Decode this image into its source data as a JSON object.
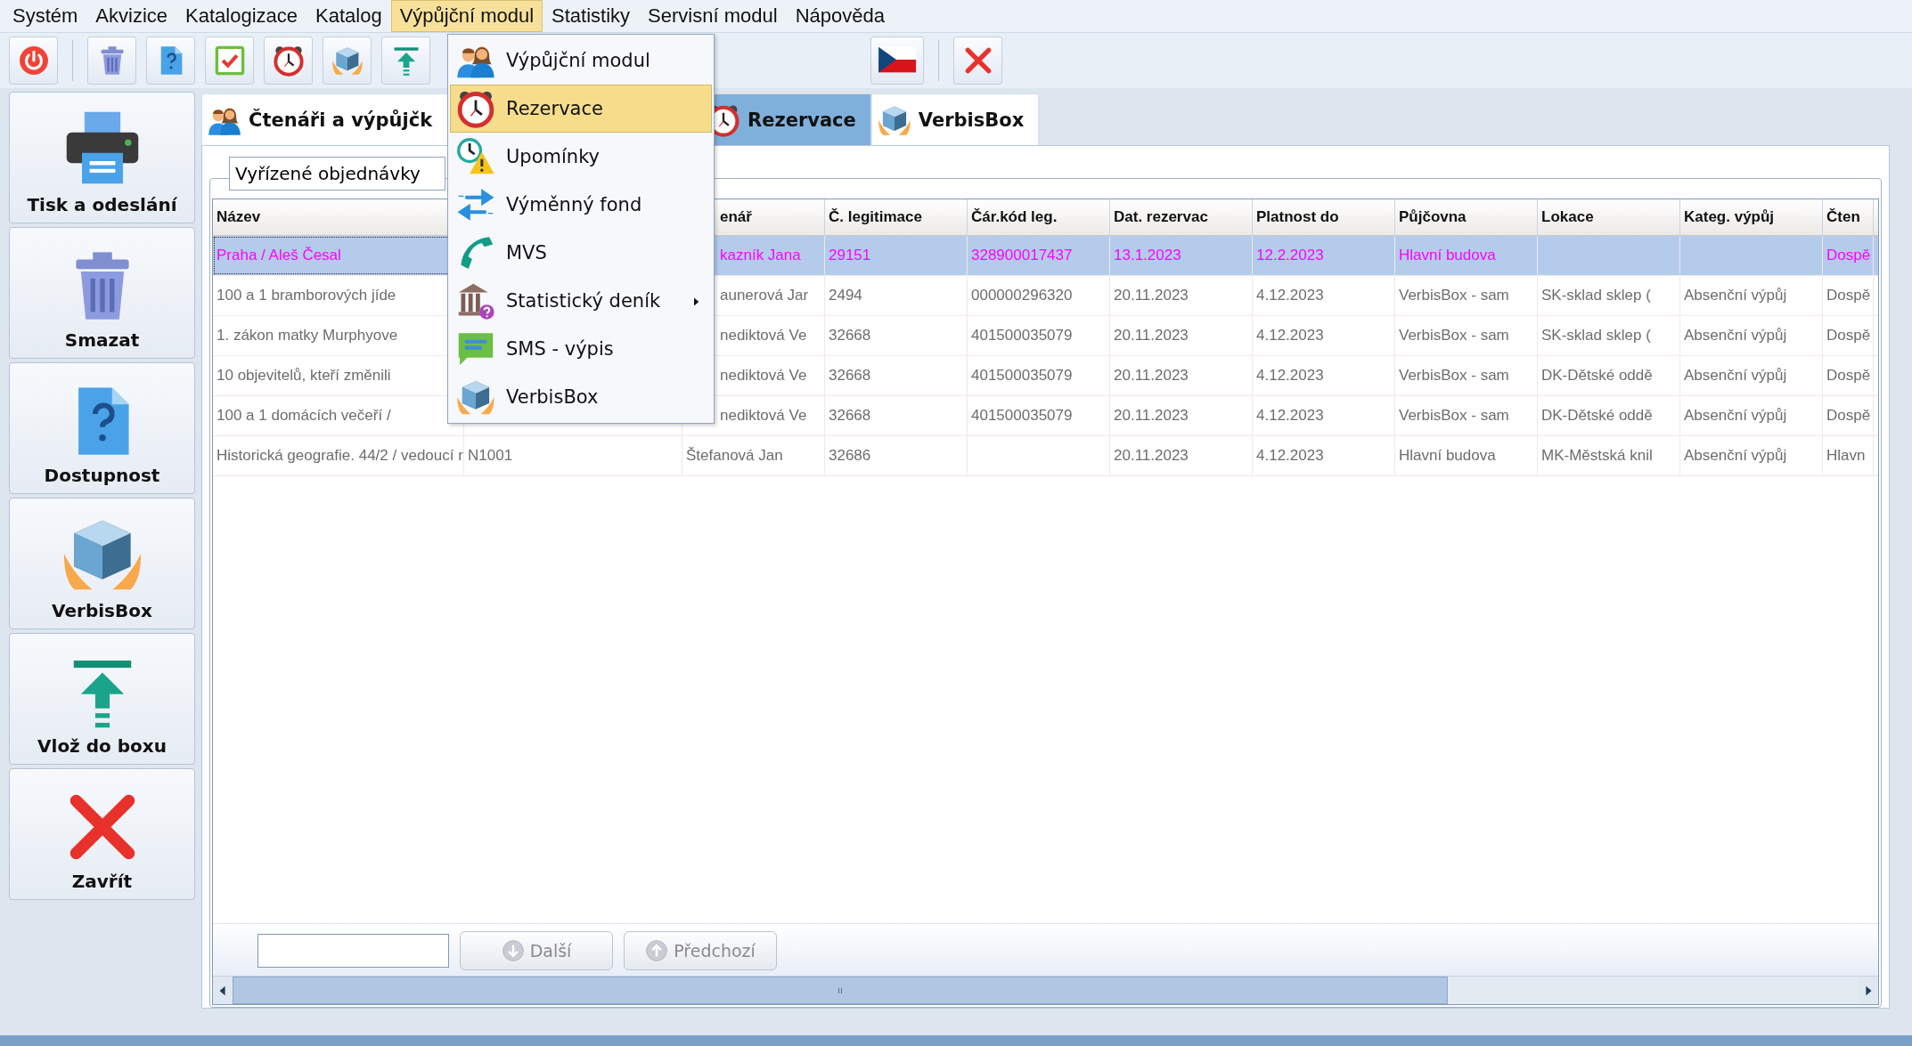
{
  "menu_bar": [
    {
      "label": "Systém",
      "selected": false
    },
    {
      "label": "Akvizice",
      "selected": false
    },
    {
      "label": "Katalogizace",
      "selected": false
    },
    {
      "label": "Katalog",
      "selected": false
    },
    {
      "label": "Výpůjční modul",
      "selected": true
    },
    {
      "label": "Statistiky",
      "selected": false
    },
    {
      "label": "Servisní modul",
      "selected": false
    },
    {
      "label": "Nápověda",
      "selected": false
    }
  ],
  "dropdown_menu": [
    {
      "label": "Výpůjční modul",
      "selected": false,
      "submenu": false
    },
    {
      "label": "Rezervace",
      "selected": true,
      "submenu": false
    },
    {
      "label": "Upomínky",
      "selected": false,
      "submenu": false
    },
    {
      "label": "Výměnný fond",
      "selected": false,
      "submenu": false
    },
    {
      "label": "MVS",
      "selected": false,
      "submenu": false
    },
    {
      "label": "Statistický deník",
      "selected": false,
      "submenu": true
    },
    {
      "label": "SMS - výpis",
      "selected": false,
      "submenu": false
    },
    {
      "label": "VerbisBox",
      "selected": false,
      "submenu": false
    }
  ],
  "sidebar": [
    {
      "label": "Tisk a odeslání"
    },
    {
      "label": "Smazat"
    },
    {
      "label": "Dostupnost"
    },
    {
      "label": "VerbisBox"
    },
    {
      "label": "Vlož do boxu"
    },
    {
      "label": "Zavřít"
    }
  ],
  "tabs": [
    {
      "label": "Čtenáři a výpůjčk",
      "selected": false
    },
    {
      "label": "Rezervace",
      "selected": true
    },
    {
      "label": "VerbisBox",
      "selected": false
    }
  ],
  "filter": {
    "value": "Vyřízené objednávky"
  },
  "table": {
    "columns": [
      "Název",
      null,
      "enář",
      "Č. legitimace",
      "Čár.kód leg.",
      "Dat. rezervac",
      "Platnost do",
      "Půjčovna",
      "Lokace",
      "Kateg. výpůj",
      "Čten"
    ],
    "rows": [
      {
        "selected": true,
        "cells": [
          "Praha / Aleš Česal",
          null,
          "kazník Jana",
          "29151",
          "328900017437",
          "13.1.2023",
          "12.2.2023",
          "Hlavní budova",
          null,
          null,
          "Dospě"
        ]
      },
      {
        "selected": false,
        "cells": [
          "100 a 1 bramborových jíde",
          null,
          "aunerová Jar",
          "2494",
          "000000296320",
          "20.11.2023",
          "4.12.2023",
          "VerbisBox - sam",
          "SK-sklad sklep (",
          "Absenční výpůj",
          "Dospě"
        ]
      },
      {
        "selected": false,
        "cells": [
          "1. zákon matky Murphyove",
          null,
          "nediktová Ve",
          "32668",
          "401500035079",
          "20.11.2023",
          "4.12.2023",
          "VerbisBox - sam",
          "SK-sklad sklep (",
          "Absenční výpůj",
          "Dospě"
        ]
      },
      {
        "selected": false,
        "cells": [
          "10 objevitelů, kteří změnili",
          null,
          "nediktová Ve",
          "32668",
          "401500035079",
          "20.11.2023",
          "4.12.2023",
          "VerbisBox - sam",
          "DK-Dětské oddě",
          "Absenční výpůj",
          "Dospě"
        ]
      },
      {
        "selected": false,
        "cells": [
          "100 a 1 domácích večeří /",
          null,
          "nediktová Ve",
          "32668",
          "401500035079",
          "20.11.2023",
          "4.12.2023",
          "VerbisBox - sam",
          "DK-Dětské oddě",
          "Absenční výpůj",
          "Dospě"
        ]
      },
      {
        "selected": false,
        "cells": [
          "Historická geografie. 44/2 / vedoucí r",
          "N1001",
          "Štefanová  Jan",
          "32686",
          null,
          "20.11.2023",
          "4.12.2023",
          "Hlavní budova",
          "MK-Městská knil",
          "Absenční výpůj",
          "Hlavn"
        ]
      }
    ]
  },
  "nav_buttons": [
    {
      "label": "Další",
      "disabled": true
    },
    {
      "label": "Předchozí",
      "disabled": true
    }
  ]
}
